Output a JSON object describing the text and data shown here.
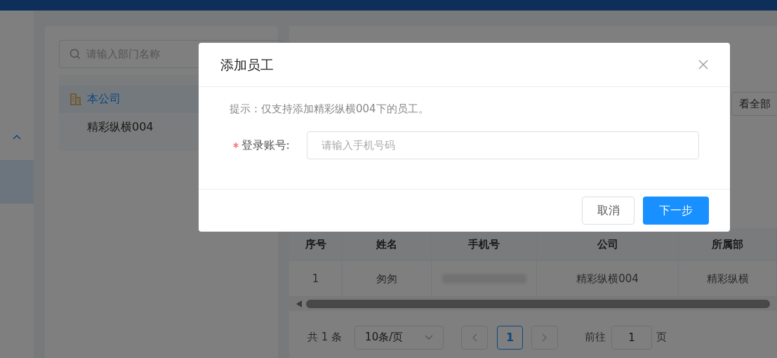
{
  "sidebar": {
    "group_expanded": true,
    "items": [
      {
        "selected": true
      }
    ]
  },
  "department_panel": {
    "search": {
      "placeholder": "请输入部门名称"
    },
    "tree": [
      {
        "label": "本公司",
        "selected": true,
        "children": [
          {
            "label": "精彩纵横004",
            "selected": false
          }
        ]
      }
    ]
  },
  "view_all_button": "看全部",
  "table": {
    "columns": [
      "序号",
      "姓名",
      "手机号",
      "公司",
      "所属部"
    ],
    "rows": [
      {
        "cells": [
          {
            "kind": "text",
            "text": "1"
          },
          {
            "kind": "text",
            "text": "匆匆"
          },
          {
            "kind": "redacted"
          },
          {
            "kind": "text",
            "text": "精彩纵横004"
          },
          {
            "kind": "text",
            "text": "精彩纵横"
          }
        ]
      }
    ]
  },
  "pagination": {
    "total": "共 1 条",
    "page_size": "10条/页",
    "pages": [
      {
        "label": "1",
        "selected": true
      }
    ],
    "goto_label": "前往",
    "goto_value": "1",
    "page_suffix": "页"
  },
  "dialog": {
    "title": "添加员工",
    "hint": "提示：仅支持添加精彩纵横004下的员工。",
    "field": {
      "label": "登录账号:",
      "required": true,
      "placeholder": "请输入手机号码"
    },
    "buttons": [
      {
        "label": "取消",
        "kind": "default"
      },
      {
        "label": "下一步",
        "kind": "primary"
      }
    ]
  }
}
